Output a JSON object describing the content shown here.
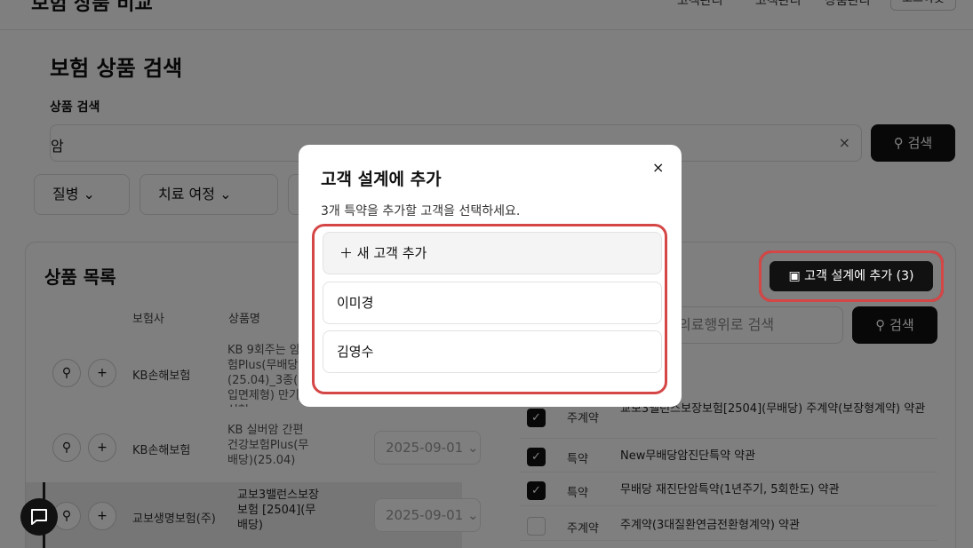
{
  "header": {
    "brand": "보험 상품 비교",
    "nav_items": [
      "고객관리",
      "고객관리",
      "상품관리"
    ],
    "nav_button": "로그아웃"
  },
  "search": {
    "title": "보험 상품 검색",
    "label": "상품 검색",
    "value": "암",
    "clear": "×",
    "button": "검색"
  },
  "filters": [
    "질병",
    "치료 여정"
  ],
  "products": {
    "title": "상품 목록",
    "columns": [
      "보험사",
      "상품명"
    ],
    "rows": [
      {
        "insurer": "KB손해보험",
        "name": "KB 9회주는 암보험Plus(무배당)(25.04)_3종(납입면제형) 만기갱신형",
        "date": ""
      },
      {
        "insurer": "KB손해보험",
        "name": "KB 실버암 간편건강보험Plus(무배당)(25.04)",
        "date": "2025-09-01"
      },
      {
        "insurer": "교보생명보험(주)",
        "name": "교보3밸런스보장보험 [2504](무배당)",
        "date": "2025-09-01"
      }
    ]
  },
  "right_panel": {
    "add_button": "고객 설계에 추가 (3)",
    "search_placeholder": "의료행위로 검색",
    "search_button": "검색",
    "clauses": [
      {
        "checked": true,
        "type": "주계약",
        "name": "교보3밸런스보장보험[2504](무배당) 주계약(보장형계약) 약관"
      },
      {
        "checked": true,
        "type": "특약",
        "name": "New무배당암진단특약 약관"
      },
      {
        "checked": true,
        "type": "특약",
        "name": "무배당 재진단암특약(1년주기, 5회한도) 약관"
      },
      {
        "checked": false,
        "type": "주계약",
        "name": "주계약(3대질환연금전환형계약) 약관"
      }
    ]
  },
  "modal": {
    "title": "고객 설계에 추가",
    "close": "×",
    "description": "3개 특약을 추가할 고객을 선택하세요.",
    "new_customer": "새 고객 추가",
    "customers": [
      "이미경",
      "김영수"
    ]
  },
  "colors": {
    "accent_red": "#d54747",
    "dark": "#111111",
    "overlay": "rgba(0,0,0,0.5)"
  },
  "icons": [
    "pin-icon",
    "plus-icon",
    "chevron-down-icon",
    "search-icon",
    "close-icon",
    "folder-plus-icon",
    "check-icon",
    "chat-icon"
  ]
}
